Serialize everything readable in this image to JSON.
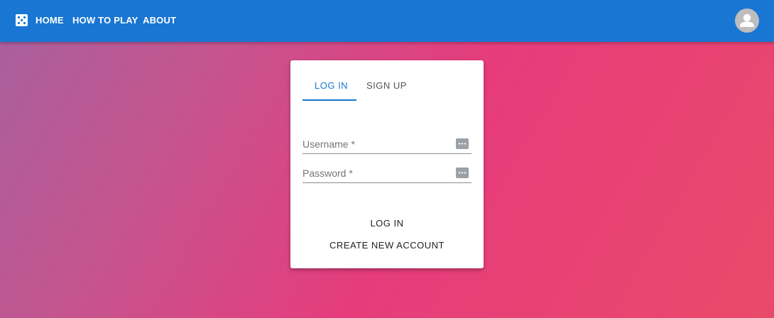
{
  "nav": {
    "logo_icon": "dice-icon",
    "home": "HOME",
    "how_to_play": "HOW TO PLAY",
    "about": "ABOUT",
    "avatar_icon": "account-icon"
  },
  "auth": {
    "tabs": [
      {
        "label": "LOG IN",
        "active": true
      },
      {
        "label": "SIGN UP",
        "active": false
      }
    ],
    "username_label": "Username *",
    "username_value": "",
    "password_label": "Password *",
    "password_value": "",
    "field_icon": "password-manager-icon",
    "login_button": "LOG IN",
    "create_account_button": "CREATE NEW ACCOUNT"
  },
  "colors": {
    "appbar": "#1976d2",
    "accent": "#1976d2",
    "gradient_start": "#a7609f",
    "gradient_mid": "#e63c7c",
    "gradient_end": "#ea4a6a"
  }
}
